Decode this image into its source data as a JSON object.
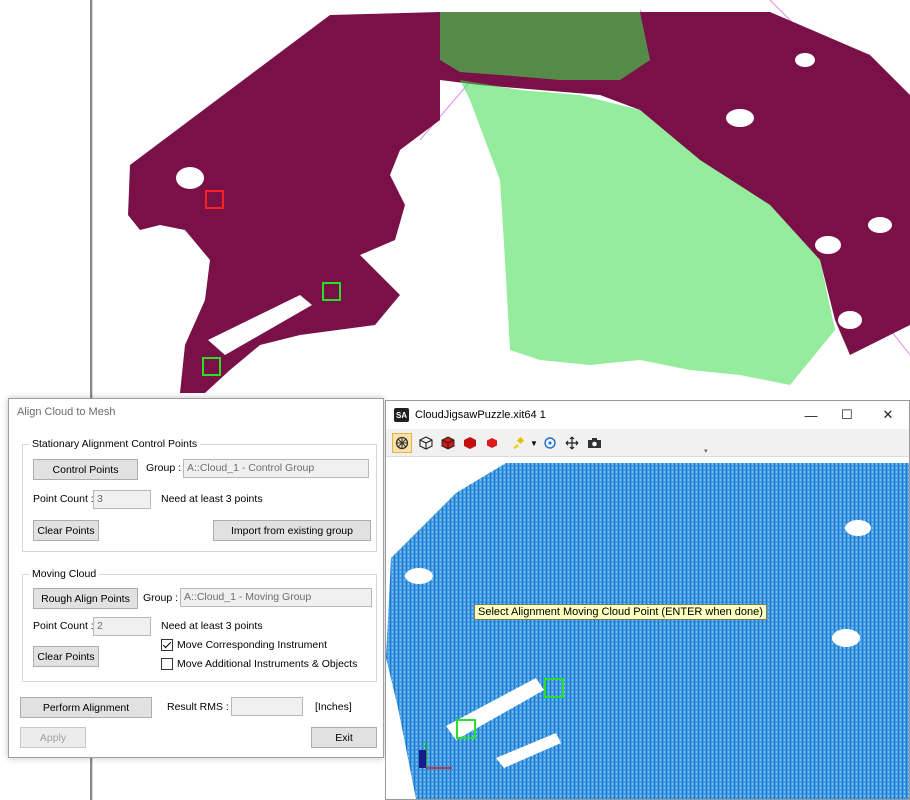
{
  "dialog": {
    "title": "Align Cloud to Mesh",
    "stationary": {
      "legend": "Stationary Alignment Control Points",
      "control_points_btn": "Control Points",
      "group_label": "Group :",
      "group_value": "A::Cloud_1 - Control Group",
      "point_count_label": "Point Count :",
      "point_count_value": "3",
      "need_text": "Need at least 3 points",
      "clear_btn": "Clear Points",
      "import_btn": "Import from existing group"
    },
    "moving": {
      "legend": "Moving Cloud",
      "rough_align_btn": "Rough Align Points",
      "group_label": "Group :",
      "group_value": "A::Cloud_1 - Moving Group",
      "point_count_label": "Point Count :",
      "point_count_value": "2",
      "need_text": "Need at least 3 points",
      "clear_btn": "Clear Points",
      "move_instrument_label": "Move Corresponding Instrument",
      "move_instrument_checked": true,
      "move_additional_label": "Move Additional Instruments & Objects",
      "move_additional_checked": false
    },
    "perform_btn": "Perform Alignment",
    "result_rms_label": "Result RMS :",
    "result_rms_value": "",
    "units": "[Inches]",
    "apply_btn": "Apply",
    "exit_btn": "Exit"
  },
  "window": {
    "logo": "SA",
    "title": "CloudJigsawPuzzle.xit64 1",
    "minimize": "—",
    "maximize": "☐",
    "close": "✕",
    "toolbar_icons": [
      "tools-icon",
      "wireframe-cube-icon",
      "shaded-cube-red-icon",
      "solid-cube-red-icon",
      "hex-red-icon",
      "color-picker-icon",
      "dropdown-arrow-icon",
      "rotate-icon",
      "pan-icon",
      "camera-icon"
    ],
    "tooltip": "Select Alignment Moving Cloud Point (ENTER when done)"
  },
  "colors": {
    "mesh": "#7a1048",
    "cloud_green": "#2ecc40",
    "cloud_blue": "#2b8fe0",
    "tooltip_bg": "#ffffbf"
  }
}
